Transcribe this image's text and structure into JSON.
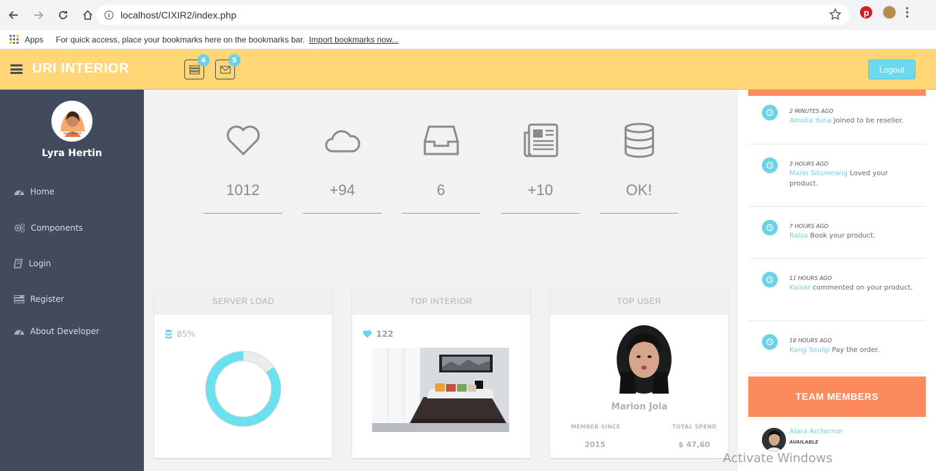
{
  "browser": {
    "url": "localhost/CIXIR2/index.php",
    "apps_label": "Apps",
    "bookmarks_hint": "For quick access, place your bookmarks here on the bookmarks bar.",
    "import_link": "Import bookmarks now..."
  },
  "header": {
    "brand": "URI INTERIOR",
    "tasks_badge": "4",
    "mail_badge": "5",
    "logout_label": "Logout",
    "accent_color": "#ffd777"
  },
  "sidebar": {
    "profile_name": "Lyra Hertin",
    "avatar_caption": "lyra hertin",
    "items": [
      {
        "label": "Home",
        "icon": "dashboard-icon"
      },
      {
        "label": "Components",
        "icon": "cogs-icon"
      },
      {
        "label": "Login",
        "icon": "book-icon"
      },
      {
        "label": "Register",
        "icon": "tasks-icon"
      },
      {
        "label": "About Developer",
        "icon": "dashboard-icon"
      }
    ]
  },
  "stats": [
    {
      "icon": "heart-icon",
      "value": "1012"
    },
    {
      "icon": "cloud-icon",
      "value": "+94"
    },
    {
      "icon": "inbox-icon",
      "value": "6"
    },
    {
      "icon": "newspaper-icon",
      "value": "+10"
    },
    {
      "icon": "database-icon",
      "value": "OK!"
    }
  ],
  "panels": {
    "server_load": {
      "title": "SERVER LOAD",
      "percent_label": "85%",
      "percent": 0.85
    },
    "top_interior": {
      "title": "TOP INTERIOR",
      "likes": "122"
    },
    "top_user": {
      "title": "TOP USER",
      "name": "Marion Jola",
      "member_since_label": "MEMBER SINCE",
      "member_since": "2015",
      "total_spend_label": "TOTAL SPEND",
      "total_spend": "$ 47,60"
    }
  },
  "feed": [
    {
      "time": "2 MINUTES AGO",
      "who": "Amalia Yuna",
      "text": " Joined to be reseller."
    },
    {
      "time": "3 HOURS AGO",
      "who": "Mario Situmeang",
      "text": " Loved your product."
    },
    {
      "time": "7 HOURS AGO",
      "who": "Raisa",
      "text": " Book your product."
    },
    {
      "time": "11 HOURS AGO",
      "who": "Kaisar",
      "text": " commented on your product."
    },
    {
      "time": "18 HOURS AGO",
      "who": "Kang Seulgi",
      "text": " Pay the order."
    }
  ],
  "team": {
    "title": "TEAM MEMBERS",
    "members": [
      {
        "name": "Alara Archernar",
        "status": "AVAILABLE"
      }
    ]
  },
  "watermark": "Activate Windows"
}
